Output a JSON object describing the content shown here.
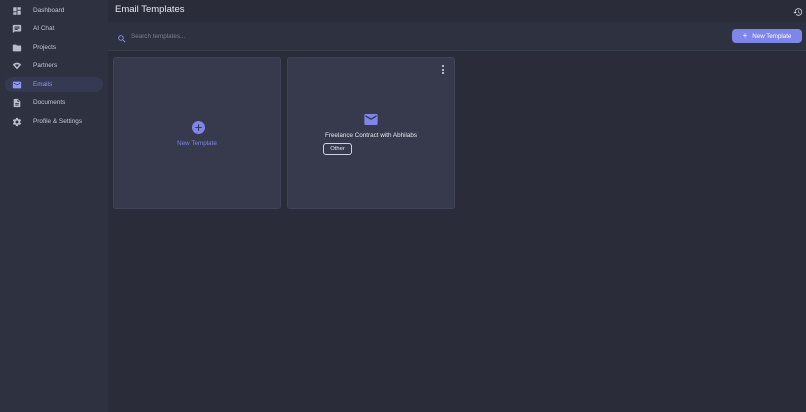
{
  "sidebar": {
    "items": [
      {
        "label": "Dashboard",
        "icon": "dashboard-icon",
        "active": false
      },
      {
        "label": "AI Chat",
        "icon": "chat-icon",
        "active": false
      },
      {
        "label": "Projects",
        "icon": "folder-icon",
        "active": false
      },
      {
        "label": "Partners",
        "icon": "handshake-icon",
        "active": false
      },
      {
        "label": "Emails",
        "icon": "mail-icon",
        "active": true
      },
      {
        "label": "Documents",
        "icon": "document-icon",
        "active": false
      },
      {
        "label": "Profile & Settings",
        "icon": "gear-icon",
        "active": false
      }
    ]
  },
  "header": {
    "title": "Email Templates",
    "history_icon": "history-icon"
  },
  "search": {
    "placeholder": "Search templates...",
    "value": ""
  },
  "toolbar": {
    "new_template_label": "New Template"
  },
  "cards": {
    "new_card_label": "New Template",
    "templates": [
      {
        "name": "Freelance Contract with Abhilabs",
        "category": "Other",
        "icon": "mail-icon"
      }
    ]
  },
  "colors": {
    "accent": "#7e86ea",
    "background": "#2a2d39",
    "sidebar": "#2e3140",
    "card": "#363a4c"
  }
}
